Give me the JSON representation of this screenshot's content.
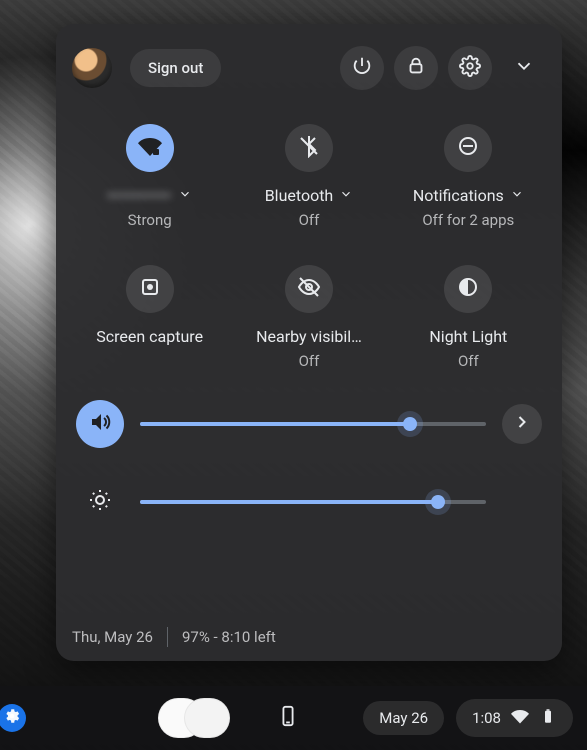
{
  "header": {
    "sign_out_label": "Sign out"
  },
  "tiles": {
    "wifi": {
      "title": "••••••••••",
      "sub": "Strong",
      "on": true
    },
    "bluetooth": {
      "title": "Bluetooth",
      "sub": "Off",
      "on": false
    },
    "notifications": {
      "title": "Notifications",
      "sub": "Off for 2 apps",
      "on": false
    },
    "capture": {
      "title": "Screen capture",
      "sub": "",
      "on": false
    },
    "nearby": {
      "title": "Nearby visibil…",
      "sub": "Off",
      "on": false
    },
    "nightlight": {
      "title": "Night Light",
      "sub": "Off",
      "on": false
    }
  },
  "sliders": {
    "volume_percent": 78,
    "brightness_percent": 86
  },
  "panel_footer": {
    "date": "Thu, May 26",
    "battery": "97% - 8:10 left"
  },
  "shelf": {
    "date_pill": "May 26",
    "time": "1:08"
  }
}
